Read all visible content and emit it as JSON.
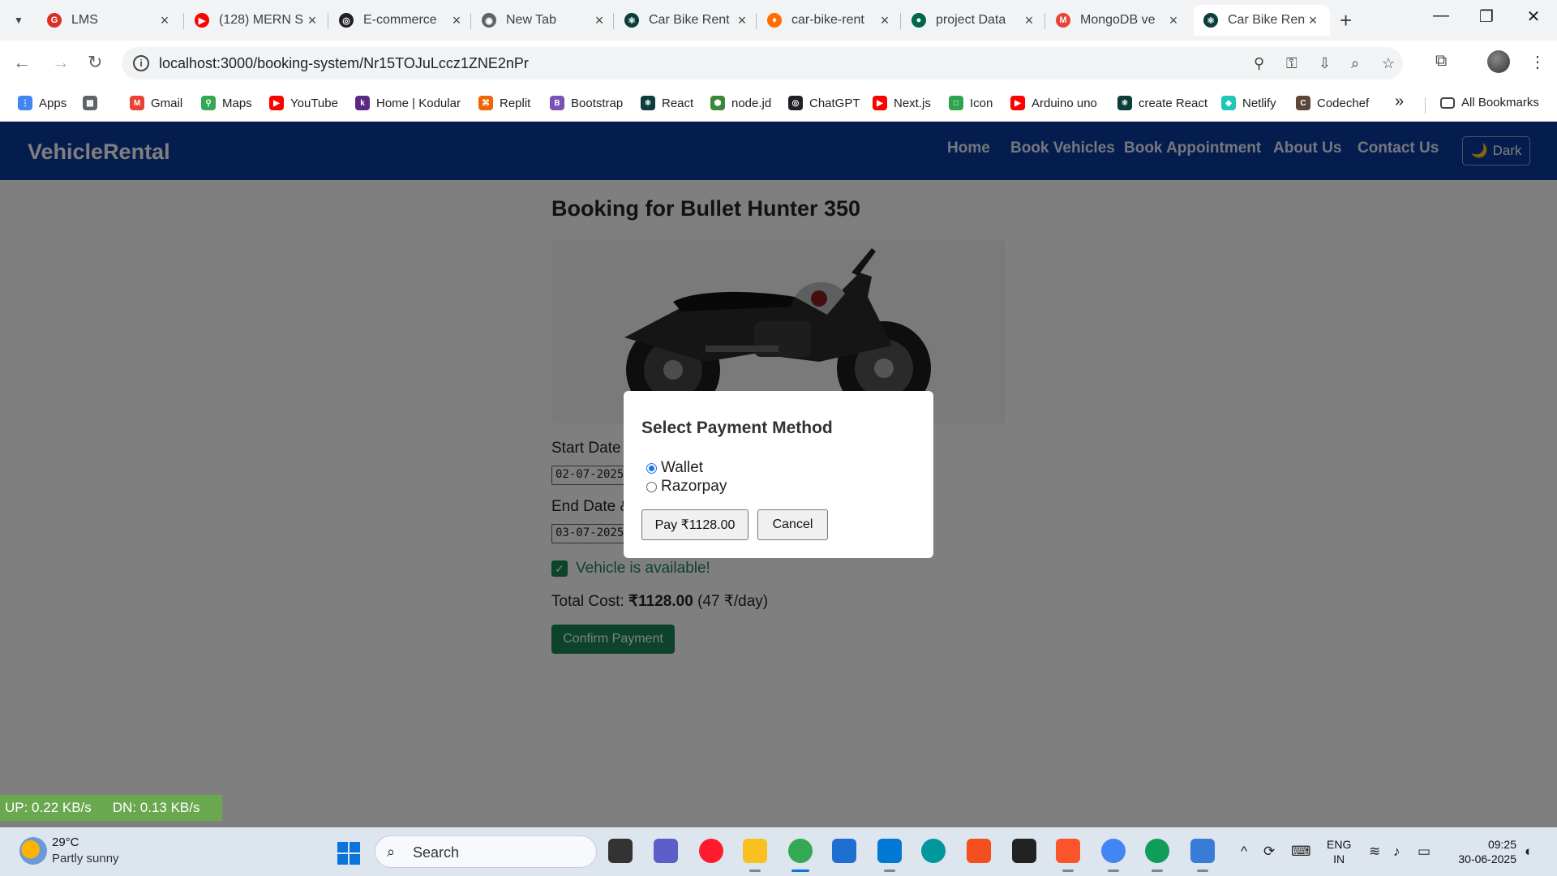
{
  "browser": {
    "tabs": [
      {
        "title": "LMS",
        "fav_color": "#d93025",
        "fav_glyph": "G"
      },
      {
        "title": "(128) MERN S",
        "fav_color": "#ff0000",
        "fav_glyph": "▶"
      },
      {
        "title": "E-commerce",
        "fav_color": "#202124",
        "fav_glyph": "◎"
      },
      {
        "title": "New Tab",
        "fav_color": "#5f6368",
        "fav_glyph": "◉"
      },
      {
        "title": "Car Bike Rent",
        "fav_color": "#0b3d3a",
        "fav_glyph": "⚛"
      },
      {
        "title": "car-bike-rent",
        "fav_color": "#ff6d00",
        "fav_glyph": "♦"
      },
      {
        "title": "project Data",
        "fav_color": "#00684a",
        "fav_glyph": "●"
      },
      {
        "title": "MongoDB ve",
        "fav_color": "#ea4335",
        "fav_glyph": "M"
      },
      {
        "title": "Car Bike Rent",
        "fav_color": "#0b3d3a",
        "fav_glyph": "⚛"
      }
    ],
    "url": "localhost:3000/booking-system/Nr15TOJuLccz1ZNE2nPr",
    "bookmarks": [
      {
        "label": "Apps",
        "color": "#4285f4",
        "glyph": "⋮"
      },
      {
        "label": "",
        "color": "#5f6368",
        "glyph": "▦"
      },
      {
        "label": "Gmail",
        "color": "#ea4335",
        "glyph": "M"
      },
      {
        "label": "Maps",
        "color": "#34a853",
        "glyph": "⚲"
      },
      {
        "label": "YouTube",
        "color": "#ff0000",
        "glyph": "▶"
      },
      {
        "label": "Home | Kodular",
        "color": "#5b2a86",
        "glyph": "k"
      },
      {
        "label": "Replit",
        "color": "#f26207",
        "glyph": "⌘"
      },
      {
        "label": "Bootstrap",
        "color": "#7952b3",
        "glyph": "B"
      },
      {
        "label": "React",
        "color": "#0b3d3a",
        "glyph": "⚛"
      },
      {
        "label": "node.jd",
        "color": "#3c873a",
        "glyph": "⬢"
      },
      {
        "label": "ChatGPT",
        "color": "#202124",
        "glyph": "◎"
      },
      {
        "label": "Next.js",
        "color": "#ff0000",
        "glyph": "▶"
      },
      {
        "label": "Icon",
        "color": "#2ea44f",
        "glyph": "□"
      },
      {
        "label": "Arduino uno",
        "color": "#ff0000",
        "glyph": "▶"
      },
      {
        "label": "create React",
        "color": "#0b3d3a",
        "glyph": "⚛"
      },
      {
        "label": "Netlify",
        "color": "#20c6b7",
        "glyph": "◆"
      },
      {
        "label": "Codechef",
        "color": "#5b4638",
        "glyph": "C"
      }
    ],
    "more_bookmarks": "»",
    "all_bookmarks": "All Bookmarks"
  },
  "site": {
    "brand": "VehicleRental",
    "nav": [
      "Home",
      "Book Vehicles",
      "Book Appointment",
      "About Us",
      "Contact Us"
    ],
    "dark_toggle": "Dark",
    "dark_icon": "🌙"
  },
  "booking": {
    "title": "Booking for Bullet Hunter 350",
    "start_label": "Start Date & Time",
    "start_value": "02-07-2025",
    "end_label": "End Date & Time",
    "end_value": "03-07-2025",
    "availability": "Vehicle is available!",
    "total_prefix": "Total Cost:",
    "total_amount": "₹1128.00",
    "total_rate": "(47 ₹/day)",
    "confirm": "Confirm Payment"
  },
  "modal": {
    "title": "Select Payment Method",
    "options": [
      {
        "label": "Wallet",
        "selected": true
      },
      {
        "label": "Razorpay",
        "selected": false
      }
    ],
    "pay_button": "Pay ₹1128.00",
    "cancel_button": "Cancel"
  },
  "netspeed": {
    "up": "UP: 0.22 KB/s",
    "down": "DN: 0.13 KB/s"
  },
  "taskbar": {
    "temperature": "29°C",
    "weather": "Partly sunny",
    "search_placeholder": "Search",
    "lang_top": "ENG",
    "lang_bottom": "IN",
    "time": "09:25",
    "date": "30-06-2025",
    "apps": [
      {
        "name": "task-view",
        "color": "#333333"
      },
      {
        "name": "teams",
        "color": "#5b5fc7"
      },
      {
        "name": "opera",
        "color": "#ff1b2d"
      },
      {
        "name": "file-explorer",
        "color": "#f8c020"
      },
      {
        "name": "chrome",
        "color": "#34a853"
      },
      {
        "name": "store",
        "color": "#1f6fd1"
      },
      {
        "name": "vscode",
        "color": "#0078d4"
      },
      {
        "name": "arduino",
        "color": "#00979d"
      },
      {
        "name": "figma",
        "color": "#f24e1e"
      },
      {
        "name": "app-black",
        "color": "#222222"
      },
      {
        "name": "brave",
        "color": "#fb542b"
      },
      {
        "name": "chrome-profile-2",
        "color": "#4285f4"
      },
      {
        "name": "chrome-profile-3",
        "color": "#0f9d58"
      },
      {
        "name": "screen-recorder",
        "color": "#3a7bd5"
      }
    ]
  }
}
